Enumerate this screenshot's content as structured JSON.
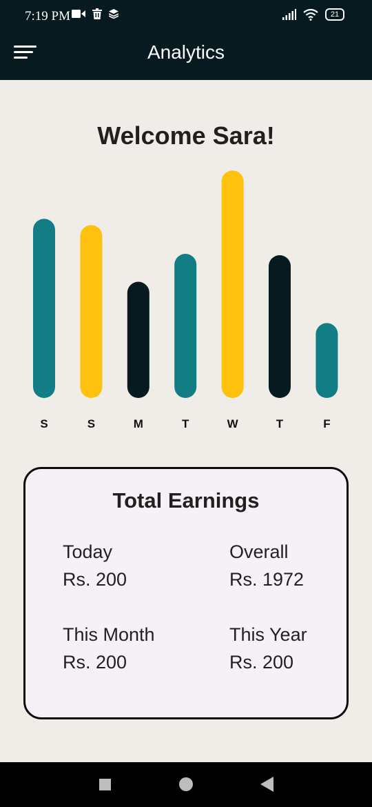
{
  "status_bar": {
    "time": "7:19 PM",
    "battery": "21",
    "icons": [
      "video-camera-icon",
      "trash-icon",
      "layers-icon",
      "signal-icon",
      "wifi-icon",
      "battery-icon"
    ]
  },
  "app_bar": {
    "title": "Analytics",
    "menu_icon": "menu-icon"
  },
  "welcome_text": "Welcome Sara!",
  "colors": {
    "teal": "#137d86",
    "yellow": "#fec10e",
    "dark": "#071a1f",
    "background": "#f0ede8",
    "card_bg": "#f5f1f7"
  },
  "chart_data": {
    "type": "bar",
    "categories": [
      "S",
      "S",
      "M",
      "T",
      "W",
      "T",
      "F"
    ],
    "values": [
      256,
      247,
      166,
      206,
      325,
      204,
      107
    ],
    "bar_colors": [
      "#137d86",
      "#fec10e",
      "#071a1f",
      "#137d86",
      "#fec10e",
      "#071a1f",
      "#137d86"
    ],
    "ylim": [
      0,
      340
    ]
  },
  "earnings": {
    "title": "Total Earnings",
    "today_label": "Today",
    "today_value": "Rs. 200",
    "overall_label": "Overall",
    "overall_value": "Rs. 1972",
    "month_label": "This Month",
    "month_value": "Rs. 200",
    "year_label": "This Year",
    "year_value": "Rs. 200"
  },
  "nav_bar": {
    "icons": [
      "recent-apps-icon",
      "home-icon",
      "back-icon"
    ]
  }
}
